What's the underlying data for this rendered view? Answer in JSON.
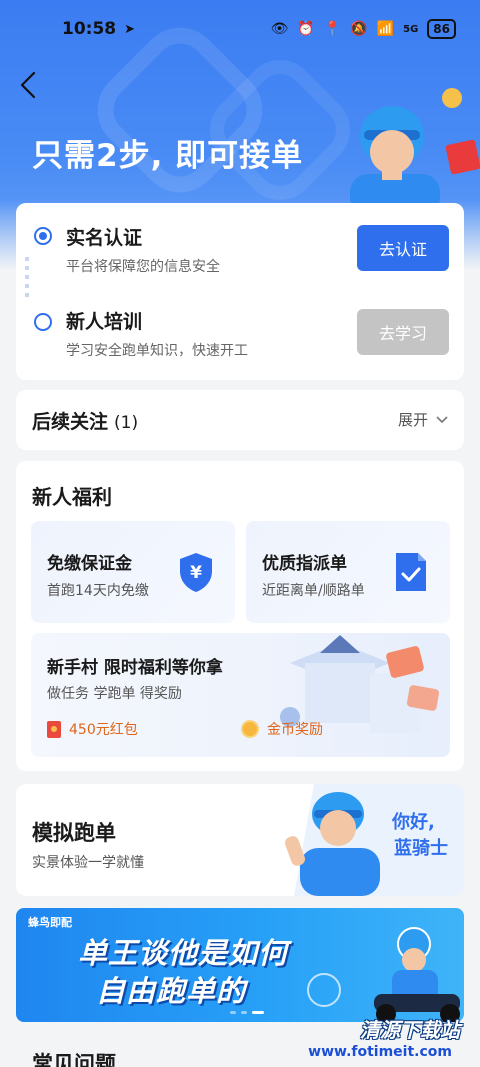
{
  "status_bar": {
    "time": "10:58",
    "network": "5G",
    "battery": "86"
  },
  "header": {
    "title": "只需2步, 即可接单"
  },
  "steps": [
    {
      "title": "实名认证",
      "desc": "平台将保障您的信息安全",
      "button": "去认证",
      "active": true
    },
    {
      "title": "新人培训",
      "desc": "学习安全跑单知识，快速开工",
      "button": "去学习",
      "active": false
    }
  ],
  "follow_up": {
    "title": "后续关注",
    "count": "(1)",
    "expand_label": "展开"
  },
  "benefits": {
    "title": "新人福利",
    "tiles": [
      {
        "title": "免缴保证金",
        "desc": "首跑14天内免缴",
        "icon": "shield-yen-icon"
      },
      {
        "title": "优质指派单",
        "desc": "近距离单/顺路单",
        "icon": "checked-document-icon"
      }
    ],
    "village": {
      "title": "新手村 限时福利等你拿",
      "desc": "做任务 学跑单 得奖励",
      "reward_1": "450元红包",
      "reward_2": "金币奖励"
    }
  },
  "simulate": {
    "title": "模拟跑单",
    "desc": "实景体验一学就懂",
    "art_text_1": "你好,",
    "art_text_2": "蓝骑士"
  },
  "banner": {
    "brand": "蜂鸟即配",
    "line1": "单王谈他是如何",
    "line2": "自由跑单的"
  },
  "faq": {
    "title": "常见问题"
  },
  "watermark": {
    "name": "清源下载站",
    "url": "www.fotimeit.com"
  },
  "colors": {
    "primary": "#2f6fee",
    "header_bg": "#3b7cf2",
    "disabled": "#c4c4c4",
    "reward": "#e0651a"
  }
}
